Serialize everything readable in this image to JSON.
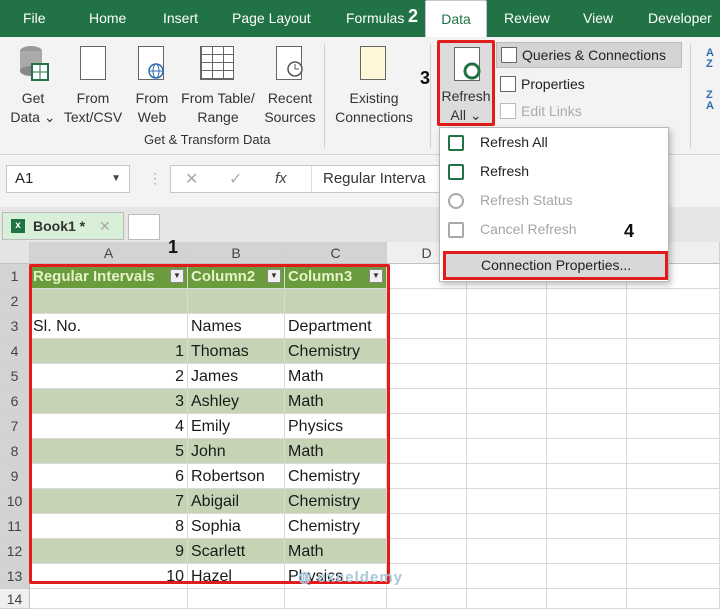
{
  "menu": {
    "file": "File",
    "home": "Home",
    "insert": "Insert",
    "page_layout": "Page Layout",
    "formulas": "Formulas",
    "data": "Data",
    "review": "Review",
    "view": "View",
    "developer": "Developer"
  },
  "ribbon": {
    "get_data": [
      "Get",
      "Data ⌄"
    ],
    "from_text": [
      "From",
      "Text/CSV"
    ],
    "from_web": [
      "From",
      "Web"
    ],
    "from_table": [
      "From Table/",
      "Range"
    ],
    "recent_sources": [
      "Recent",
      "Sources"
    ],
    "existing_connections": [
      "Existing",
      "Connections"
    ],
    "refresh_all": [
      "Refresh",
      "All ⌄"
    ],
    "queries_connections": "Queries & Connections",
    "properties": "Properties",
    "edit_links": "Edit Links",
    "group_label": "Get & Transform Data",
    "sort_az": "A Z",
    "sort_za": "Z A"
  },
  "dropdown": {
    "items": [
      {
        "label": "Refresh All",
        "disabled": false,
        "icon": "refresh-all-icon"
      },
      {
        "label": "Refresh",
        "disabled": false,
        "icon": "refresh-icon"
      },
      {
        "label": "Refresh Status",
        "disabled": true,
        "icon": "info-icon"
      },
      {
        "label": "Cancel Refresh",
        "disabled": true,
        "icon": "cancel-refresh-icon"
      },
      {
        "label": "Connection Properties...",
        "disabled": false,
        "icon": ""
      }
    ]
  },
  "formula_bar": {
    "name_box": "A1",
    "cancel": "✕",
    "enter": "✓",
    "fx": "fx",
    "content": "Regular Interva"
  },
  "workbook_tab": "Book1 *",
  "columns": [
    "A",
    "B",
    "C",
    "D"
  ],
  "rows": [
    "1",
    "2",
    "3",
    "4",
    "5",
    "6",
    "7",
    "8",
    "9",
    "10",
    "11",
    "12",
    "13",
    "14"
  ],
  "table": {
    "headers": [
      "Regular Intervals",
      "Column2",
      "Column3"
    ],
    "row3": [
      "Sl. No.",
      "Names",
      "Department"
    ],
    "data": [
      [
        "1",
        "Thomas",
        "Chemistry"
      ],
      [
        "2",
        "James",
        "Math"
      ],
      [
        "3",
        "Ashley",
        "Math"
      ],
      [
        "4",
        "Emily",
        "Physics"
      ],
      [
        "5",
        "John",
        "Math"
      ],
      [
        "6",
        "Robertson",
        "Chemistry"
      ],
      [
        "7",
        "Abigail",
        "Chemistry"
      ],
      [
        "8",
        "Sophia",
        "Chemistry"
      ],
      [
        "9",
        "Scarlett",
        "Math"
      ],
      [
        "10",
        "Hazel",
        "Physics"
      ]
    ]
  },
  "steps": [
    "1",
    "2",
    "3",
    "4"
  ],
  "watermark": "exceldemy",
  "colors": {
    "excel_green": "#217346",
    "table_header": "#6a9b3d",
    "band": "#c5d4b5",
    "highlight": "#e21b1b"
  }
}
